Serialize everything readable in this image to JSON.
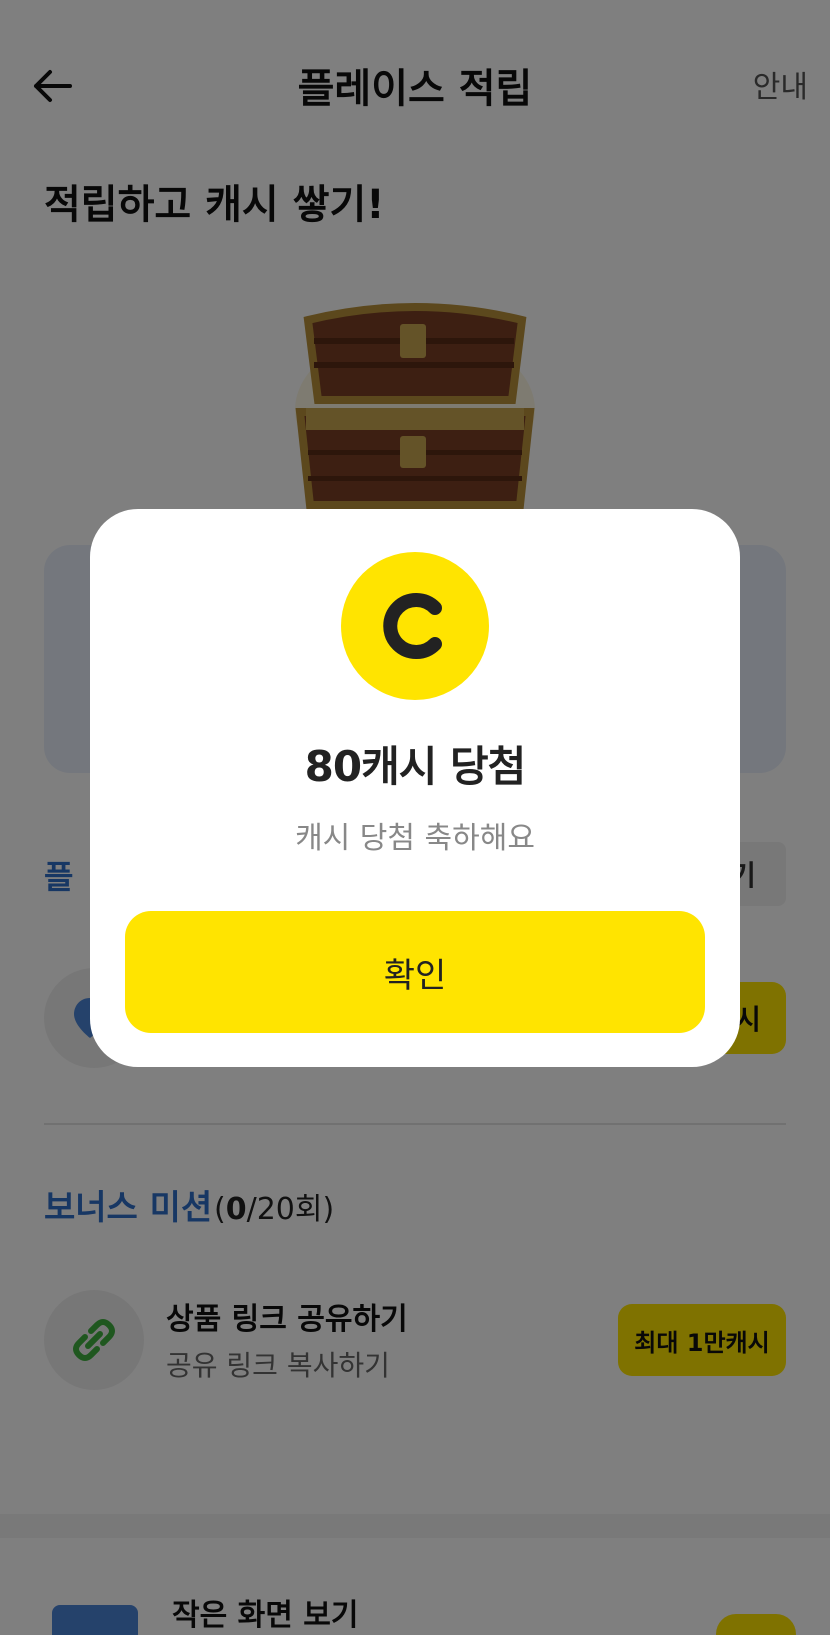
{
  "header": {
    "title": "플레이스 적립",
    "info_label": "안내"
  },
  "headline": "적립하고 캐시 쌓기!",
  "place_section": {
    "label": "플",
    "grey_button_label": "기",
    "yellow_button_label": "시"
  },
  "bonus": {
    "title": "보너스 미션",
    "count_prefix": "(",
    "count_done": "0",
    "count_rest": "/20회)"
  },
  "mission": {
    "title": "상품 링크 공유하기",
    "subtitle": "공유 링크 복사하기",
    "button_label": "최대 1만캐시",
    "icon": "link-icon"
  },
  "small_view": {
    "label": "작은 화면 보기"
  },
  "modal": {
    "coin_letter": "C",
    "title": "80캐시 당첨",
    "subtitle": "캐시 당첨 축하해요",
    "confirm_label": "확인"
  },
  "colors": {
    "accent_yellow": "#ffe400",
    "accent_blue": "#2f6ec8",
    "overlay": "rgba(0,0,0,0.5)"
  }
}
